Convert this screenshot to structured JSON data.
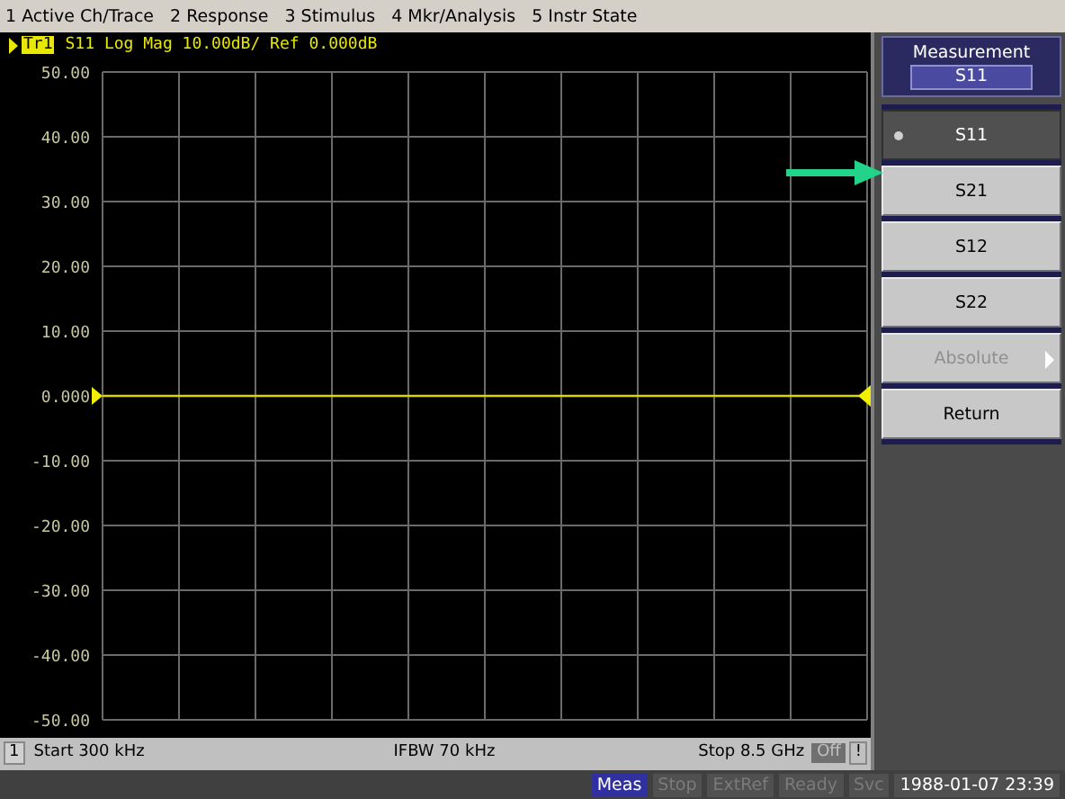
{
  "menu": [
    "1 Active Ch/Trace",
    "2 Response",
    "3 Stimulus",
    "4 Mkr/Analysis",
    "5 Instr State"
  ],
  "trace": {
    "badge": "Tr1",
    "title": "S11 Log Mag 10.00dB/ Ref 0.000dB"
  },
  "chart_data": {
    "type": "line",
    "grid": true,
    "ylim": [
      -50,
      50
    ],
    "yticks": [
      {
        "value": 50,
        "label": "50.00"
      },
      {
        "value": 40,
        "label": "40.00"
      },
      {
        "value": 30,
        "label": "30.00"
      },
      {
        "value": 20,
        "label": "20.00"
      },
      {
        "value": 10,
        "label": "10.00"
      },
      {
        "value": 0,
        "label": "0.000"
      },
      {
        "value": -10,
        "label": "-10.00"
      },
      {
        "value": -20,
        "label": "-20.00"
      },
      {
        "value": -30,
        "label": "-30.00"
      },
      {
        "value": -40,
        "label": "-40.00"
      },
      {
        "value": -50,
        "label": "-50.00"
      }
    ],
    "series": [
      {
        "color": "#d8d800",
        "values": [
          0,
          0,
          0,
          0,
          0,
          0,
          0,
          0,
          0,
          0,
          0
        ]
      }
    ]
  },
  "channel_status": {
    "channel": "1",
    "start": "Start 300 kHz",
    "ifbw": "IFBW 70 kHz",
    "stop": "Stop 8.5 GHz",
    "off": "Off",
    "flag": "!"
  },
  "softkeys": {
    "title": "Measurement",
    "value": "S11",
    "buttons": [
      {
        "label": "S11",
        "selected": true,
        "disabled": false,
        "kind": "option"
      },
      {
        "label": "S21",
        "selected": false,
        "disabled": false,
        "kind": "option"
      },
      {
        "label": "S12",
        "selected": false,
        "disabled": false,
        "kind": "option"
      },
      {
        "label": "S22",
        "selected": false,
        "disabled": false,
        "kind": "option"
      },
      {
        "label": "Absolute",
        "selected": false,
        "disabled": true,
        "kind": "submenu"
      },
      {
        "label": "Return",
        "selected": false,
        "disabled": false,
        "kind": "action"
      }
    ]
  },
  "status_bar": {
    "indicators": [
      {
        "label": "Meas",
        "on": true
      },
      {
        "label": "Stop",
        "on": false
      },
      {
        "label": "ExtRef",
        "on": false
      },
      {
        "label": "Ready",
        "on": false
      },
      {
        "label": "Svc",
        "on": false
      }
    ],
    "datetime": "1988-01-07 23:39"
  }
}
